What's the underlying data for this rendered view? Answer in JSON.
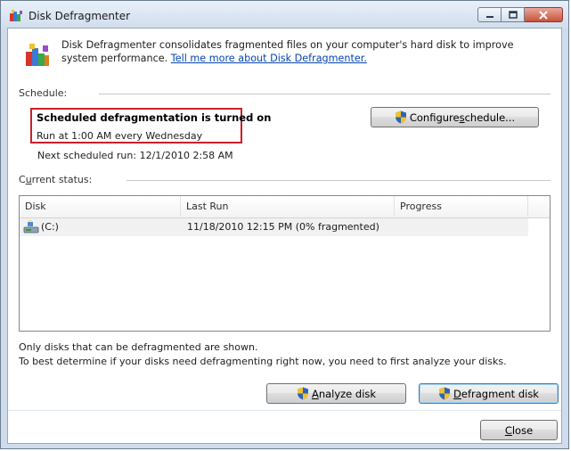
{
  "window": {
    "title": "Disk Defragmenter"
  },
  "description": {
    "text": "Disk Defragmenter consolidates fragmented files on your computer's hard disk to improve system performance.",
    "link": "Tell me more about Disk Defragmenter."
  },
  "schedule": {
    "label": "Schedule:",
    "status_title": "Scheduled defragmentation is turned on",
    "status_detail": "Run at 1:00 AM every Wednesday",
    "next_run": "Next scheduled run: 12/1/2010 2:58 AM",
    "configure_pre": "Configure ",
    "configure_key": "s",
    "configure_post": "chedule..."
  },
  "status": {
    "label_key": "u",
    "label_pre": "C",
    "label_post": "rrent status:",
    "columns": [
      "Disk",
      "Last Run",
      "Progress"
    ],
    "rows": [
      {
        "disk": "(C:)",
        "last_run": "11/18/2010 12:15 PM (0% fragmented)",
        "progress": ""
      }
    ]
  },
  "notes": {
    "line1": "Only disks that can be defragmented are shown.",
    "line2": "To best determine if your disks need defragmenting right now, you need to first analyze your disks."
  },
  "buttons": {
    "analyze_key": "A",
    "analyze_post": "nalyze disk",
    "defrag_key": "D",
    "defrag_post": "efragment disk",
    "close_key": "C",
    "close_post": "lose"
  },
  "colors": {
    "highlight_border": "#c8202a",
    "link": "#0645ad"
  }
}
